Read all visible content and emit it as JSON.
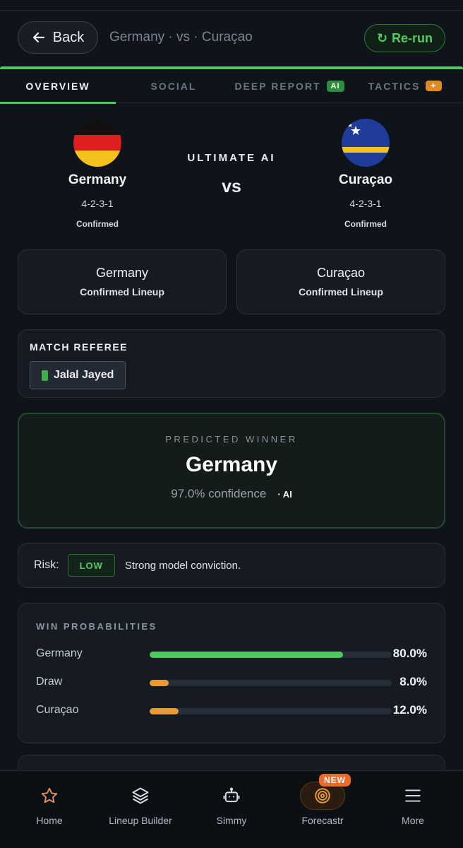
{
  "header": {
    "back_label": "Back",
    "match_title": "Germany · vs · Curaçao",
    "rerun_label": "Re-run"
  },
  "tabs": [
    {
      "label": "OVERVIEW",
      "active": true
    },
    {
      "label": "SOCIAL",
      "active": false
    },
    {
      "label": "DEEP REPORT",
      "badge": "AI",
      "active": false
    },
    {
      "label": "TACTICS",
      "badge": "+",
      "active": false
    }
  ],
  "match": {
    "mode_label": "ULTIMATE AI",
    "vs_label": "vs",
    "home": {
      "name": "Germany",
      "formation": "4-2-3-1",
      "status": "Confirmed",
      "flag_icon": "germany-flag-icon"
    },
    "away": {
      "name": "Curaçao",
      "formation": "4-2-3-1",
      "status": "Confirmed",
      "flag_icon": "curacao-flag-icon"
    }
  },
  "lineups": {
    "home": {
      "team": "Germany",
      "label": "Confirmed Lineup"
    },
    "away": {
      "team": "Curaçao",
      "label": "Confirmed Lineup"
    }
  },
  "referee": {
    "title": "MATCH REFEREE",
    "name": "Jalal Jayed"
  },
  "prediction": {
    "label": "PREDICTED WINNER",
    "winner": "Germany",
    "confidence": "97.0% confidence",
    "source": "· AI"
  },
  "risk": {
    "label": "Risk:",
    "level": "LOW",
    "text": "Strong model conviction."
  },
  "win_probabilities": {
    "title": "WIN PROBABILITIES",
    "rows": [
      {
        "name": "Germany",
        "value_label": "80.0%",
        "fraction": 0.8,
        "color": "#4ec95f"
      },
      {
        "name": "Draw",
        "value_label": "8.0%",
        "fraction": 0.08,
        "color": "#e89a33"
      },
      {
        "name": "Curaçao",
        "value_label": "12.0%",
        "fraction": 0.12,
        "color": "#e89a33"
      }
    ]
  },
  "nav": [
    {
      "label": "Home",
      "icon": "star-icon"
    },
    {
      "label": "Lineup Builder",
      "icon": "layers-icon"
    },
    {
      "label": "Simmy",
      "icon": "robot-icon"
    },
    {
      "label": "Forecastr",
      "icon": "target-icon",
      "badge": "NEW"
    },
    {
      "label": "More",
      "icon": "menu-icon"
    }
  ],
  "colors": {
    "accent_green": "#4ec95f",
    "accent_orange": "#e89a33",
    "background": "#0f131a"
  }
}
